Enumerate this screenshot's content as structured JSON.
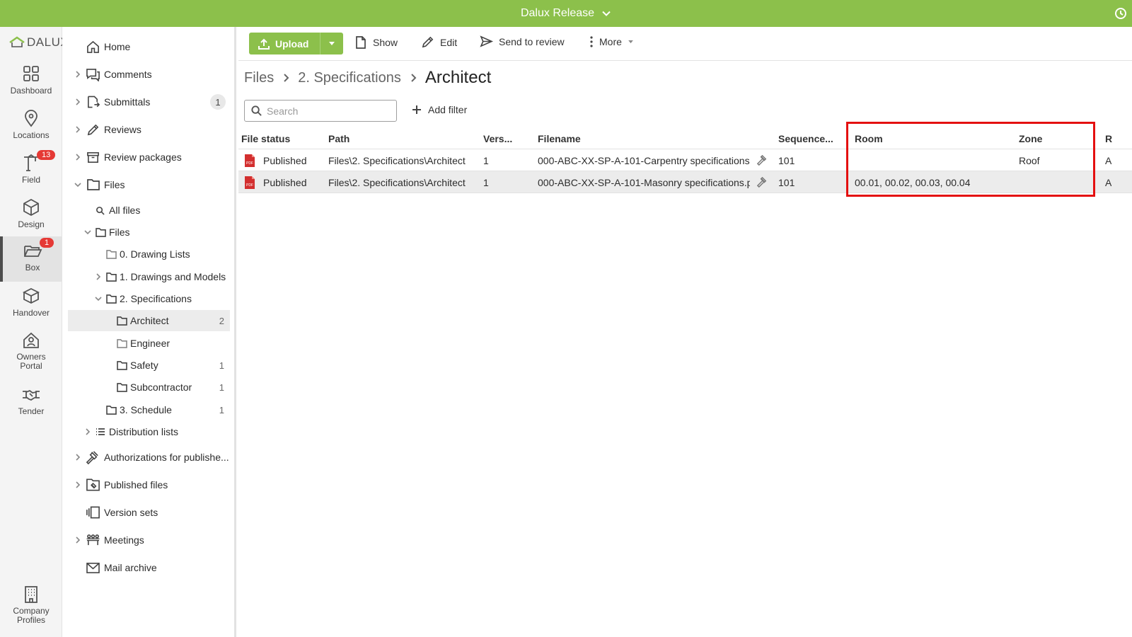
{
  "topbar": {
    "project_name": "Dalux Release"
  },
  "logo": {
    "text": "DALUX"
  },
  "rail": {
    "items": [
      {
        "label": "Dashboard",
        "icon": "dashboard-icon"
      },
      {
        "label": "Locations",
        "icon": "location-pin-icon"
      },
      {
        "label": "Field",
        "icon": "crane-icon",
        "badge": "13"
      },
      {
        "label": "Design",
        "icon": "cube-icon"
      },
      {
        "label": "Box",
        "icon": "folder-open-icon",
        "badge": "1",
        "active": true
      },
      {
        "label": "Handover",
        "icon": "box-icon"
      },
      {
        "label": "Owners",
        "label2": "Portal",
        "icon": "house-user-icon"
      },
      {
        "label": "Tender",
        "icon": "handshake-icon"
      },
      {
        "label": "Company",
        "label2": "Profiles",
        "icon": "building-icon"
      }
    ]
  },
  "tree": {
    "home": "Home",
    "comments": "Comments",
    "submittals": "Submittals",
    "submittals_count": "1",
    "reviews": "Reviews",
    "review_packages": "Review packages",
    "files": "Files",
    "all_files": "All files",
    "files_sub": "Files",
    "drawing_lists": "0. Drawing Lists",
    "drawings_models": "1. Drawings and Models",
    "specifications": "2. Specifications",
    "architect": "Architect",
    "architect_count": "2",
    "engineer": "Engineer",
    "safety": "Safety",
    "safety_count": "1",
    "subcontractor": "Subcontractor",
    "subcontractor_count": "1",
    "schedule": "3. Schedule",
    "schedule_count": "1",
    "distribution_lists": "Distribution lists",
    "authorizations": "Authorizations for publishe...",
    "published_files": "Published files",
    "version_sets": "Version sets",
    "meetings": "Meetings",
    "mail_archive": "Mail archive"
  },
  "toolbar": {
    "upload": "Upload",
    "show": "Show",
    "edit": "Edit",
    "send_to_review": "Send to review",
    "more": "More"
  },
  "breadcrumb": {
    "items": [
      "Files",
      "2. Specifications"
    ],
    "current": "Architect"
  },
  "search": {
    "placeholder": "Search"
  },
  "filter": {
    "add_label": "Add filter"
  },
  "table": {
    "columns": [
      "File status",
      "Path",
      "Vers...",
      "Filename",
      "Sequence...",
      "Room",
      "Zone",
      "R"
    ],
    "rows": [
      {
        "status": "Published",
        "path": "Files\\2. Specifications\\Architect",
        "version": "1",
        "filename": "000-ABC-XX-SP-A-101-Carpentry specifications....",
        "sequence": "101",
        "room": "",
        "zone": "Roof",
        "extra": "A"
      },
      {
        "status": "Published",
        "path": "Files\\2. Specifications\\Architect",
        "version": "1",
        "filename": "000-ABC-XX-SP-A-101-Masonry specifications.p...",
        "sequence": "101",
        "room": "00.01, 00.02, 00.03, 00.04",
        "zone": "",
        "extra": "A"
      }
    ]
  },
  "colors": {
    "brand_green": "#8cc04b",
    "badge_red": "#e53935",
    "highlight_red": "#e41010",
    "pdf_red": "#d32f2f"
  }
}
